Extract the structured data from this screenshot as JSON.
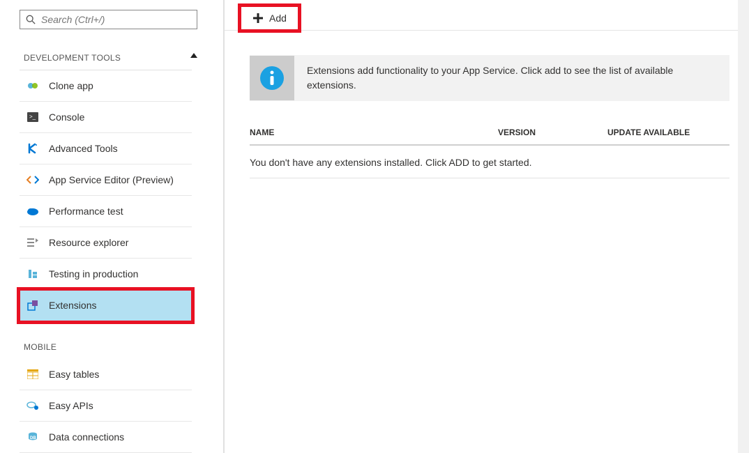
{
  "sidebar": {
    "search_placeholder": "Search (Ctrl+/)",
    "sections": [
      {
        "label": "DEVELOPMENT TOOLS",
        "items": [
          {
            "label": "Clone app",
            "icon": "clone-app-icon"
          },
          {
            "label": "Console",
            "icon": "console-icon"
          },
          {
            "label": "Advanced Tools",
            "icon": "kudu-icon"
          },
          {
            "label": "App Service Editor (Preview)",
            "icon": "code-icon"
          },
          {
            "label": "Performance test",
            "icon": "cloud-icon"
          },
          {
            "label": "Resource explorer",
            "icon": "resource-explorer-icon"
          },
          {
            "label": "Testing in production",
            "icon": "testing-icon"
          },
          {
            "label": "Extensions",
            "icon": "extensions-icon",
            "selected": true
          }
        ]
      },
      {
        "label": "MOBILE",
        "items": [
          {
            "label": "Easy tables",
            "icon": "easy-tables-icon"
          },
          {
            "label": "Easy APIs",
            "icon": "easy-apis-icon"
          },
          {
            "label": "Data connections",
            "icon": "data-connections-icon"
          }
        ]
      }
    ]
  },
  "toolbar": {
    "add_label": "Add"
  },
  "info": {
    "message": "Extensions add functionality to your App Service. Click add to see the list of available extensions."
  },
  "table": {
    "headers": {
      "name": "NAME",
      "version": "VERSION",
      "update": "UPDATE AVAILABLE"
    },
    "empty_message": "You don't have any extensions installed. Click ADD to get started."
  },
  "highlights": [
    "add-button",
    "sidebar-item-extensions"
  ]
}
